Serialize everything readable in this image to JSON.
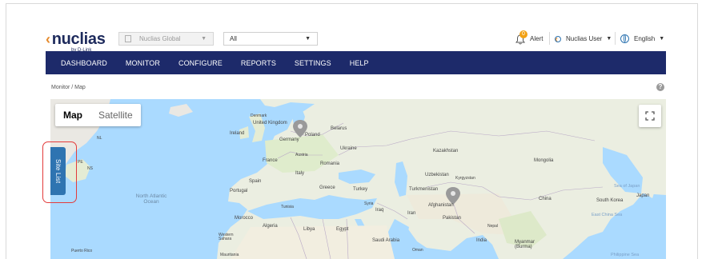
{
  "brand": {
    "name": "nuclias",
    "sub": "by D-Link"
  },
  "header": {
    "org_select": {
      "value": "Nuclias Global"
    },
    "site_select": {
      "value": "All"
    },
    "alert": {
      "label": "Alert",
      "count": "0"
    },
    "user": {
      "label": "Nuclias User"
    },
    "language": {
      "label": "English"
    }
  },
  "nav": {
    "items": [
      {
        "label": "DASHBOARD"
      },
      {
        "label": "MONITOR"
      },
      {
        "label": "CONFIGURE"
      },
      {
        "label": "REPORTS"
      },
      {
        "label": "SETTINGS"
      },
      {
        "label": "HELP"
      }
    ]
  },
  "breadcrumb": "Monitor / Map",
  "help_icon": "?",
  "map": {
    "types": [
      {
        "label": "Map",
        "active": true
      },
      {
        "label": "Satellite",
        "active": false
      }
    ],
    "site_list_label": "Site List",
    "labels": {
      "ireland": "Ireland",
      "uk": "United Kingdom",
      "denmark": "Denmark",
      "germany": "Germany",
      "poland": "Poland",
      "belarus": "Belarus",
      "ukraine": "Ukraine",
      "austria": "Austria",
      "france": "France",
      "romania": "Romania",
      "italy": "Italy",
      "spain": "Spain",
      "portugal": "Portugal",
      "greece": "Greece",
      "turkey": "Turkey",
      "syria": "Syria",
      "iraq": "Iraq",
      "iran": "Iran",
      "tunisia": "Tunisia",
      "morocco": "Morocco",
      "algeria": "Algeria",
      "libya": "Libya",
      "egypt": "Egypt",
      "western_sahara": "Western Sahara",
      "mauritania": "Mauritania",
      "saudi": "Saudi Arabia",
      "oman": "Oman",
      "kazakhstan": "Kazakhstan",
      "uzbekistan": "Uzbekistan",
      "kyrgyzstan": "Kyrgyzstan",
      "turkmenistan": "Turkmenistan",
      "afghanistan": "Afghanistan",
      "pakistan": "Pakistan",
      "nepal": "Nepal",
      "india": "India",
      "myanmar": "Myanmar (Burma)",
      "mongolia": "Mongolia",
      "china": "China",
      "south_korea": "South Korea",
      "japan": "Japan",
      "sea_of_japan": "Sea of Japan",
      "east_china_sea": "East China Sea",
      "philippine_sea": "Philippine Sea",
      "puerto_rico": "Puerto Rico",
      "north_atlantic": "North Atlantic Ocean",
      "nl": "NL",
      "ns": "NS",
      "pe": "PE"
    }
  }
}
